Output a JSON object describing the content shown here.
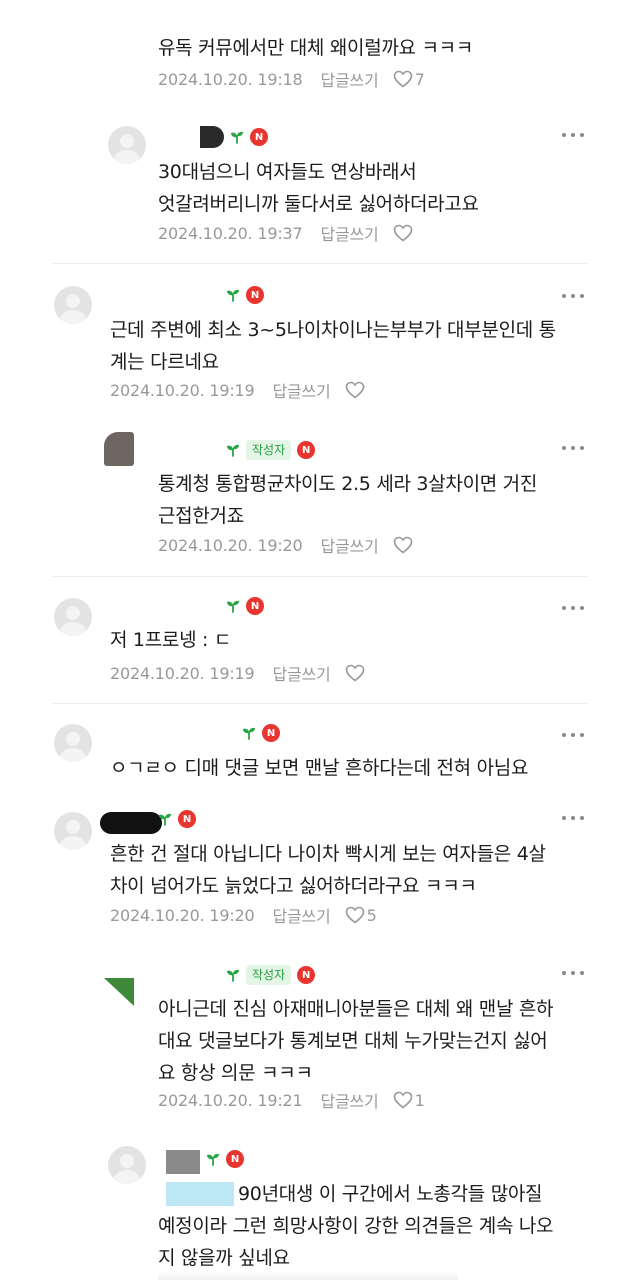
{
  "comments": [
    {
      "id": "c0",
      "text_lines": [
        "유독 커뮤에서만 대체 왜이럴까요 ㅋㅋㅋ"
      ],
      "date": "2024.10.20. 19:18",
      "reply_label": "답글쓰기",
      "likes": "7"
    },
    {
      "id": "c1",
      "text_lines": [
        "30대넘으니 여자들도 연상바래서",
        "엇갈려버리니까 둘다서로 싫어하더라고요"
      ],
      "date": "2024.10.20. 19:37",
      "reply_label": "답글쓰기",
      "likes": ""
    },
    {
      "id": "c2",
      "text_lines": [
        "근데 주변에 최소 3~5나이차이나는부부가 대부분인데 통",
        "계는 다르네요"
      ],
      "date": "2024.10.20. 19:19",
      "reply_label": "답글쓰기",
      "likes": ""
    },
    {
      "id": "c3",
      "author_badge": "작성자",
      "text_lines": [
        "통계청 통합평균차이도 2.5 세라 3살차이면 거진",
        "근접한거죠"
      ],
      "date": "2024.10.20. 19:20",
      "reply_label": "답글쓰기",
      "likes": ""
    },
    {
      "id": "c4",
      "text_lines": [
        "저 1프로넹 : ㄷ"
      ],
      "date": "2024.10.20. 19:19",
      "reply_label": "답글쓰기",
      "likes": ""
    },
    {
      "id": "c5",
      "text_lines": [
        "ㅇㄱㄹㅇ 디매 댓글 보면 맨날 흔하다는데 전혀 아님요"
      ]
    },
    {
      "id": "c6",
      "text_lines": [
        "흔한 건 절대 아닙니다 나이차 빡시게 보는 여자들은 4살",
        "차이 넘어가도 늙었다고 싫어하더라구요 ㅋㅋㅋ"
      ],
      "date": "2024.10.20. 19:20",
      "reply_label": "답글쓰기",
      "likes": "5"
    },
    {
      "id": "c7",
      "author_badge": "작성자",
      "text_lines": [
        "아니근데 진심 아재매니아분들은 대체 왜 맨날 흔하",
        "대요 댓글보다가 통계보면 대체 누가맞는건지 싫어",
        "요 항상 의문 ㅋㅋㅋ"
      ],
      "date": "2024.10.20. 19:21",
      "reply_label": "답글쓰기",
      "likes": "1"
    },
    {
      "id": "c8",
      "text_lines": [
        "90년대생 이 구간에서 노총각들 많아질",
        "예정이라 그런 희망사항이 강한 의견들은 계속 나오",
        "지 않을까 싶네요"
      ]
    }
  ],
  "badges": {
    "naver": "N"
  },
  "colors": {
    "sprout": "#27a644",
    "naver_badge": "#e8352f",
    "author_badge_bg": "#e4f5e7",
    "meta_gray": "#999999"
  }
}
